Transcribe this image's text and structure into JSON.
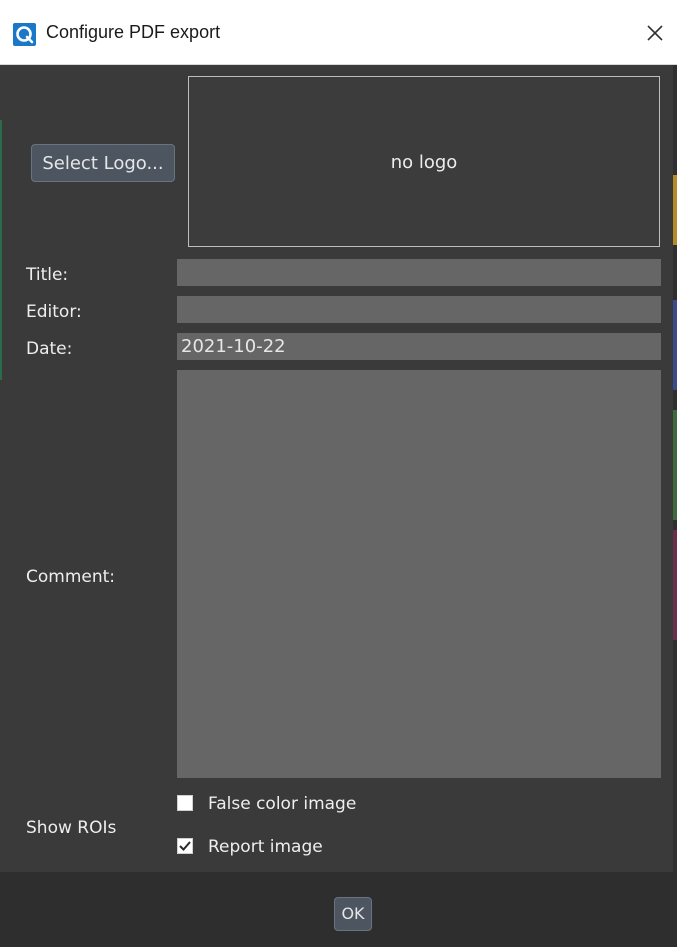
{
  "window": {
    "title": "Configure PDF export"
  },
  "logo": {
    "select_label": "Select Logo...",
    "placeholder_text": "no logo"
  },
  "form": {
    "title_label": "Title:",
    "title_value": "",
    "editor_label": "Editor:",
    "editor_value": "",
    "date_label": "Date:",
    "date_value": "2021-10-22",
    "comment_label": "Comment:",
    "comment_value": ""
  },
  "show_rois": {
    "label": "Show ROIs",
    "options": [
      {
        "label": "False color image",
        "checked": false
      },
      {
        "label": "Report image",
        "checked": true
      }
    ]
  },
  "footer": {
    "ok_label": "OK"
  },
  "colors": {
    "background": "#3a3a3a",
    "field": "#666666",
    "accent_icon": "#1b78c8",
    "footer": "#2e2e2e"
  },
  "icons": {
    "app": "app-logo-icon",
    "close": "close-icon",
    "checkbox_checked": "checkmark-icon"
  }
}
